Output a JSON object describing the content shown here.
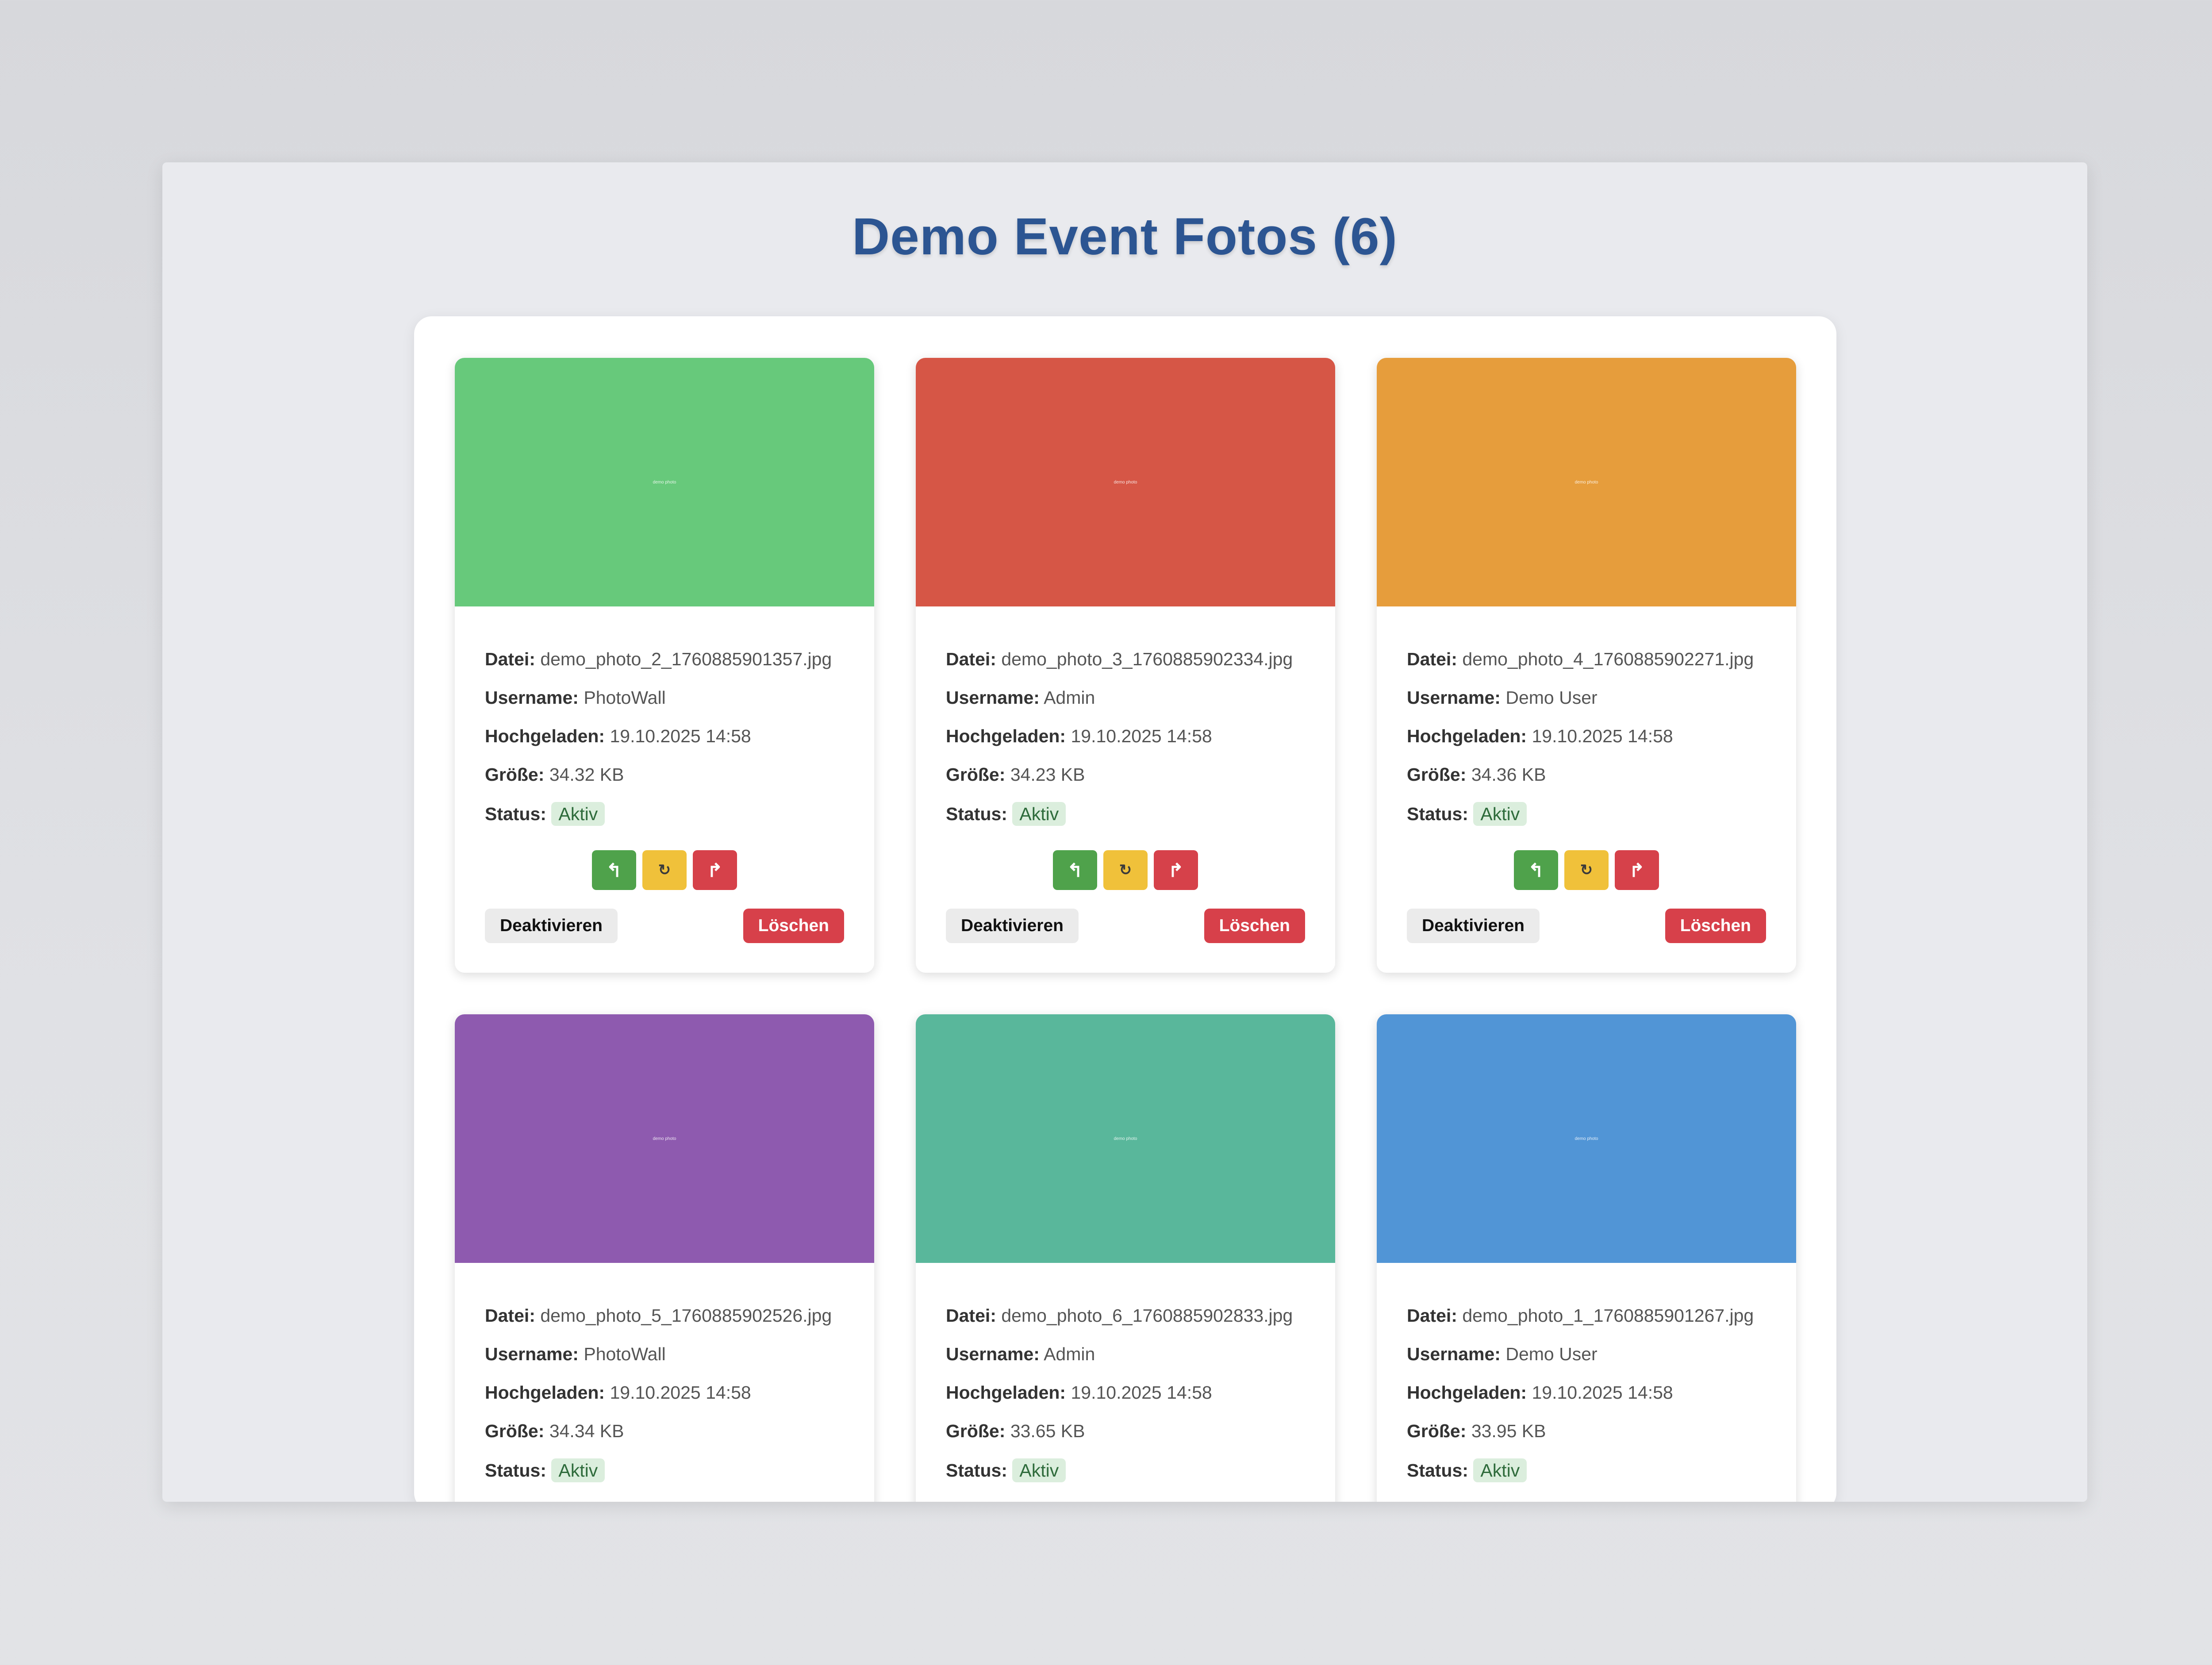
{
  "page": {
    "title": "Demo Event Fotos (6)"
  },
  "labels": {
    "file": "Datei:",
    "username": "Username:",
    "uploaded": "Hochgeladen:",
    "size": "Größe:",
    "status": "Status:",
    "deactivate": "Deaktivieren",
    "delete": "Löschen",
    "rotate_left": "↰",
    "reset": "↻",
    "rotate_right": "↱"
  },
  "photos": [
    {
      "color": "#67c97b",
      "file": "demo_photo_2_1760885901357.jpg",
      "username": "PhotoWall",
      "uploaded": "19.10.2025 14:58",
      "size": "34.32 KB",
      "status": "Aktiv",
      "thumb_text": "demo photo"
    },
    {
      "color": "#d65646",
      "file": "demo_photo_3_1760885902334.jpg",
      "username": "Admin",
      "uploaded": "19.10.2025 14:58",
      "size": "34.23 KB",
      "status": "Aktiv",
      "thumb_text": "demo photo"
    },
    {
      "color": "#e69d3c",
      "file": "demo_photo_4_1760885902271.jpg",
      "username": "Demo User",
      "uploaded": "19.10.2025 14:58",
      "size": "34.36 KB",
      "status": "Aktiv",
      "thumb_text": "demo photo"
    },
    {
      "color": "#8e5aaf",
      "file": "demo_photo_5_1760885902526.jpg",
      "username": "PhotoWall",
      "uploaded": "19.10.2025 14:58",
      "size": "34.34 KB",
      "status": "Aktiv",
      "thumb_text": "demo photo"
    },
    {
      "color": "#59b79b",
      "file": "demo_photo_6_1760885902833.jpg",
      "username": "Admin",
      "uploaded": "19.10.2025 14:58",
      "size": "33.65 KB",
      "status": "Aktiv",
      "thumb_text": "demo photo"
    },
    {
      "color": "#5195d6",
      "file": "demo_photo_1_1760885901267.jpg",
      "username": "Demo User",
      "uploaded": "19.10.2025 14:58",
      "size": "33.95 KB",
      "status": "Aktiv",
      "thumb_text": "demo photo"
    }
  ]
}
